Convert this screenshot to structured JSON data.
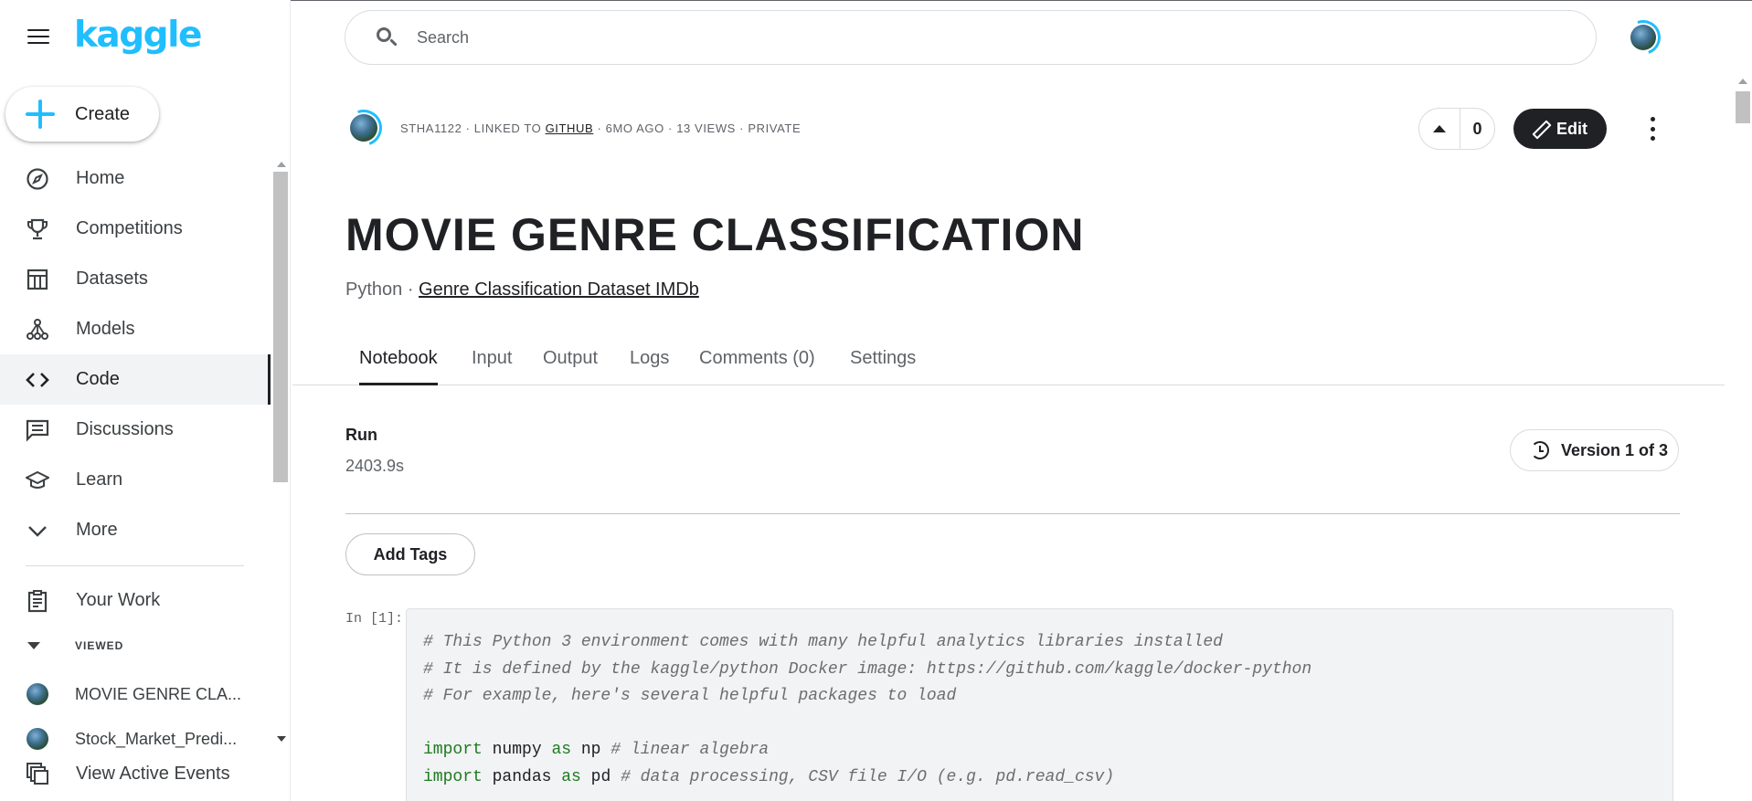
{
  "sidebar": {
    "logo": "kaggle",
    "create_label": "Create",
    "nav": [
      {
        "label": "Home",
        "icon": "compass-icon"
      },
      {
        "label": "Competitions",
        "icon": "trophy-icon"
      },
      {
        "label": "Datasets",
        "icon": "table-icon"
      },
      {
        "label": "Models",
        "icon": "models-icon"
      },
      {
        "label": "Code",
        "icon": "code-icon",
        "active": true
      },
      {
        "label": "Discussions",
        "icon": "comments-icon"
      },
      {
        "label": "Learn",
        "icon": "school-icon"
      },
      {
        "label": "More",
        "icon": "chevron-down-icon"
      }
    ],
    "your_work": "Your Work",
    "viewed_heading": "VIEWED",
    "recent": [
      "MOVIE GENRE CLA...",
      "Stock_Market_Predi..."
    ],
    "active_events": "View Active Events"
  },
  "search": {
    "placeholder": "Search"
  },
  "notebook": {
    "meta": {
      "author": "STHA1122",
      "linked_prefix": "LINKED TO",
      "linked_to": "GITHUB",
      "age": "6MO AGO",
      "views": "13 VIEWS",
      "visibility": "PRIVATE",
      "sep": " · "
    },
    "votes": "0",
    "edit_label": "Edit",
    "title": "MOVIE GENRE CLASSIFICATION",
    "language": "Python",
    "dataset": "Genre Classification Dataset IMDb",
    "tabs": [
      "Notebook",
      "Input",
      "Output",
      "Logs",
      "Comments (0)",
      "Settings"
    ],
    "active_tab": "Notebook",
    "run_label": "Run",
    "run_time": "2403.9s",
    "version_label": "Version 1 of 3",
    "add_tags_label": "Add Tags",
    "cell_prompt": "In [1]:",
    "code": {
      "line1": "# This Python 3 environment comes with many helpful analytics libraries installed",
      "line2": "# It is defined by the kaggle/python Docker image: https://github.com/kaggle/docker-python",
      "line3": "# For example, here's several helpful packages to load",
      "line5_kw1": "import",
      "line5_mod": " numpy ",
      "line5_kw2": "as",
      "line5_alias": " np ",
      "line5_comment": "# linear algebra",
      "line6_kw1": "import",
      "line6_mod": " pandas ",
      "line6_kw2": "as",
      "line6_alias": " pd ",
      "line6_comment": "# data processing, CSV file I/O (e.g. pd.read_csv)"
    }
  },
  "colors": {
    "brand": "#20beff",
    "dark": "#202124",
    "keyword": "#1f7a1f"
  }
}
